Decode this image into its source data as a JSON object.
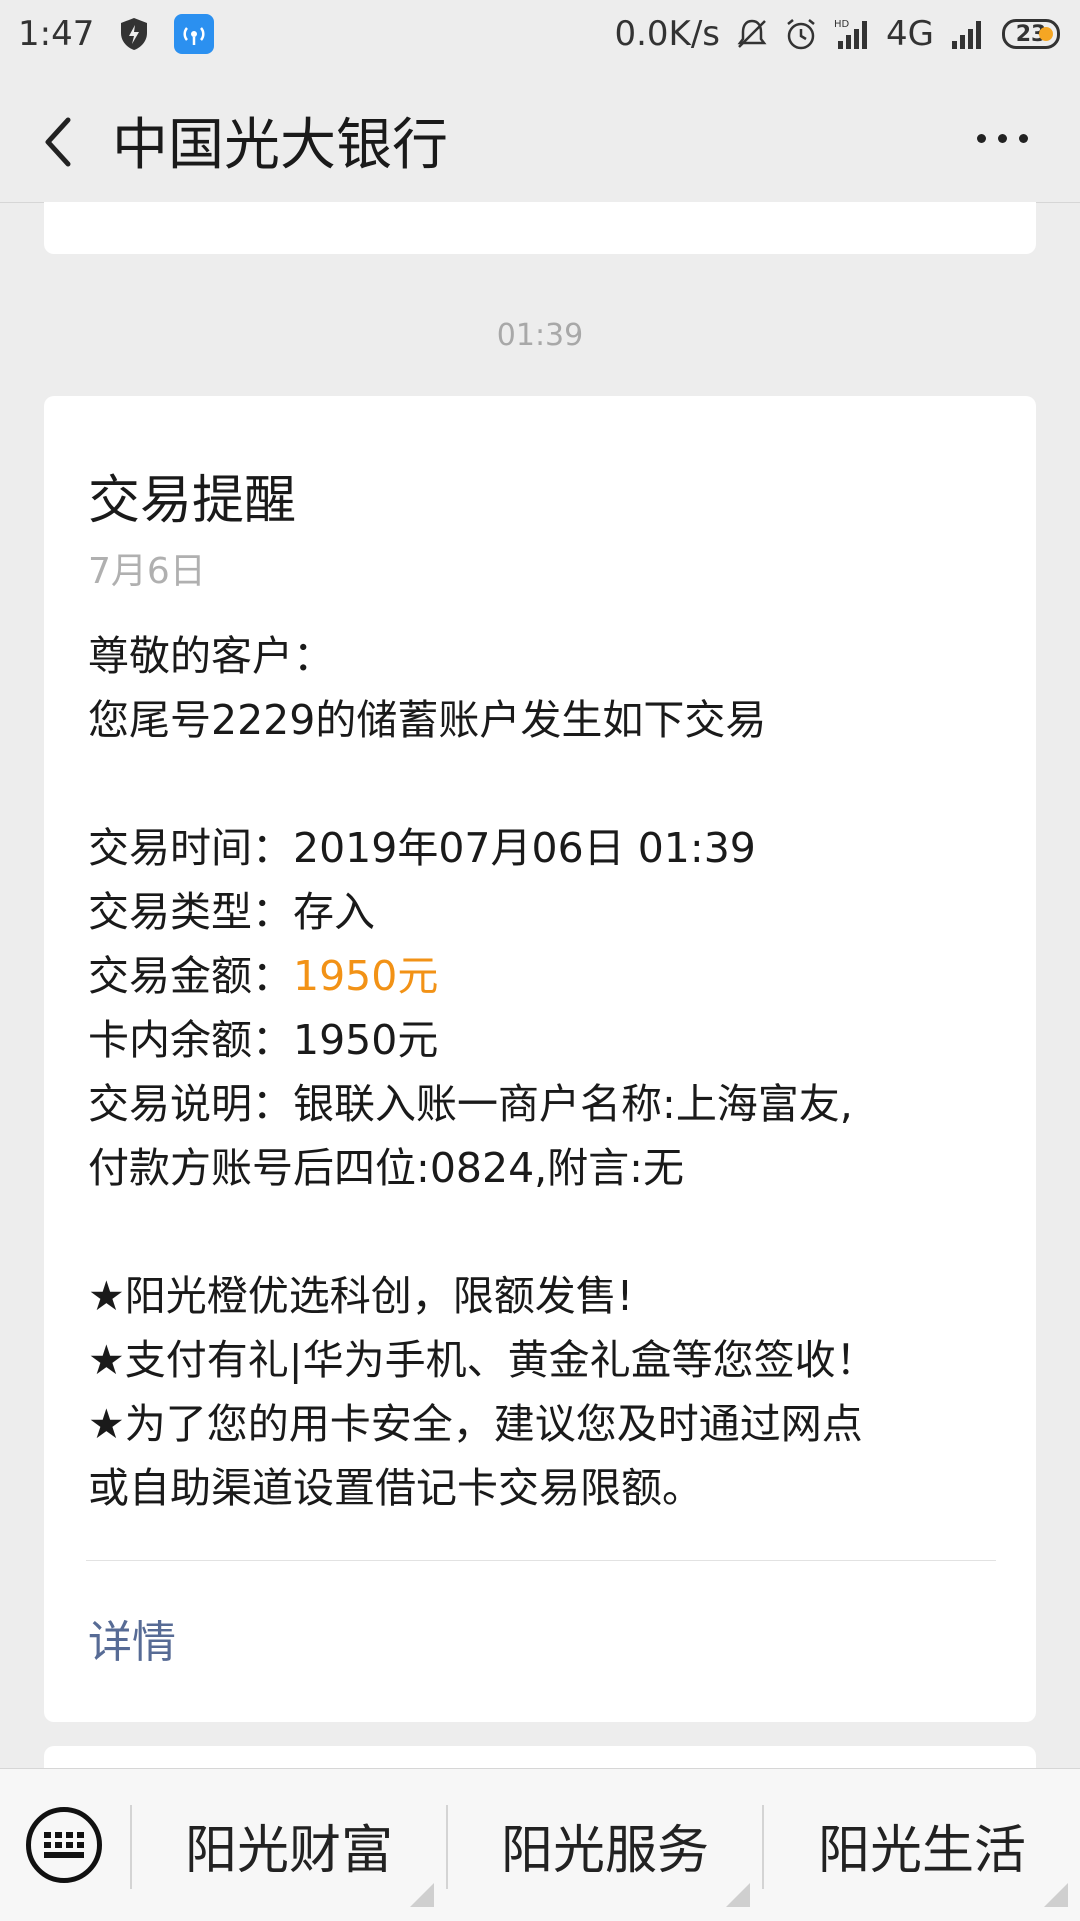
{
  "status_bar": {
    "time": "1:47",
    "network_speed": "0.0K/s",
    "network_type": "4G",
    "battery": "23",
    "hd_label": "HD",
    "app_icon": "wifi-signal-app-icon"
  },
  "header": {
    "title": "中国光大银行",
    "back_icon": "chevron-left-icon",
    "more_icon": "more-dots-icon"
  },
  "chat": {
    "timestamp": "01:39"
  },
  "message": {
    "title": "交易提醒",
    "date": "7月6日",
    "greeting": "尊敬的客户：",
    "intro": "您尾号2229的储蓄账户发生如下交易",
    "fields": [
      {
        "label": "交易时间：",
        "value": "2019年07月06日  01:39"
      },
      {
        "label": "交易类型：",
        "value": "存入"
      },
      {
        "label": "交易金额：",
        "value": "1950元"
      },
      {
        "label": "卡内余额：",
        "value": "1950元"
      },
      {
        "label": "交易说明：",
        "value": "银联入账一商户名称:上海富友,"
      }
    ],
    "desc_cont": "付款方账号后四位:0824,附言:无",
    "promos": [
      "★阳光橙优选科创，限额发售!",
      "★支付有礼|华为手机、黄金礼盒等您签收！",
      "★为了您的用卡安全，建议您及时通过网点",
      "或自助渠道设置借记卡交易限额。"
    ],
    "detail_link": "详情"
  },
  "bottom_menu": {
    "items": [
      "阳光财富",
      "阳光服务",
      "阳光生活"
    ]
  },
  "colors": {
    "amount": "#f29216",
    "link": "#576b95",
    "background": "#ededed"
  }
}
